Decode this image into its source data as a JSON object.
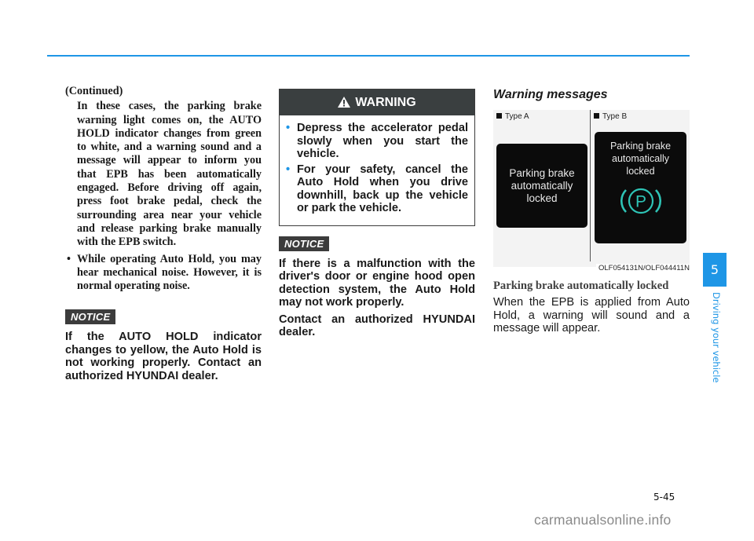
{
  "header": {
    "accent_color": "#1e96e6"
  },
  "column1": {
    "continued": "(Continued)",
    "paragraph": "In these cases, the parking brake warning light comes on, the AUTO HOLD indicator changes from green to white, and a warning sound and a message will appear to inform you that EPB has been automatically engaged. Before driving off again, press foot brake pedal, check the surrounding area near your vehicle and release parking brake manually with the EPB switch.",
    "bullet": "While operating Auto Hold, you may hear mechanical noise. However, it is normal operating noise.",
    "notice_label": "NOTICE",
    "notice_text": "If the AUTO HOLD indicator changes to yellow, the Auto Hold is not working properly. Contact an authorized HYUNDAI dealer."
  },
  "column2": {
    "warning": {
      "title": "WARNING",
      "items": [
        "Depress the accelerator pedal slowly when you start the vehicle.",
        "For your safety, cancel the Auto Hold when you drive downhill, back up the vehicle or park the vehicle."
      ]
    },
    "notice_label": "NOTICE",
    "notice_paragraphs": [
      "If there is a malfunction with the driver's door or engine hood open detection system, the Auto Hold may not work properly.",
      "Contact an authorized HYUNDAI dealer."
    ]
  },
  "column3": {
    "section_title": "Warning messages",
    "figure": {
      "type_a_label": "Type A",
      "type_b_label": "Type B",
      "panel_a_text": [
        "Parking brake",
        "automatically",
        "locked"
      ],
      "panel_b_text": [
        "Parking brake",
        "automatically",
        "locked"
      ],
      "panel_b_icon": "parking-brake-icon",
      "icon_color": "#2ec4b6",
      "code": "OLF054131N/OLF044411N"
    },
    "subtitle": "Parking brake automatically locked",
    "body": "When the EPB is applied from Auto Hold, a warning will sound and a message will appear."
  },
  "side_tab": {
    "chapter_number": "5",
    "chapter_title": "Driving your vehicle"
  },
  "footer": {
    "page_number": "5-45",
    "watermark": "carmanualsonline.info"
  }
}
